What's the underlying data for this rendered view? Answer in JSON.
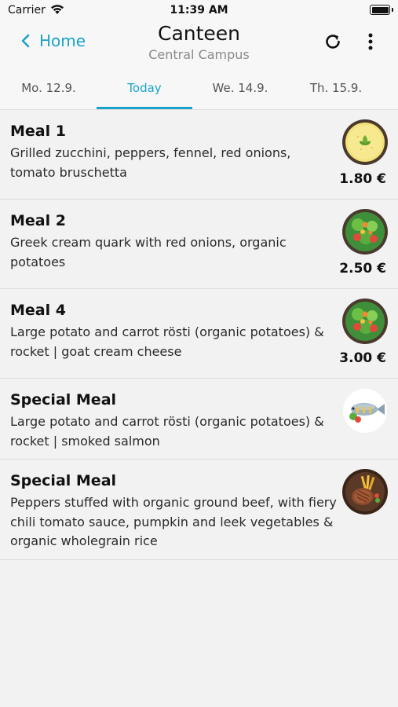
{
  "status_bar": {
    "carrier": "Carrier",
    "time": "11:39 AM"
  },
  "nav": {
    "back_label": "Home",
    "title": "Canteen",
    "subtitle": "Central Campus"
  },
  "tabs": [
    {
      "label": "Mo. 12.9.",
      "active": false
    },
    {
      "label": "Today",
      "active": true
    },
    {
      "label": "We. 14.9.",
      "active": false
    },
    {
      "label": "Th. 15.9.",
      "active": false
    }
  ],
  "meals": [
    {
      "name": "Meal 1",
      "description": "Grilled zucchini, peppers, fennel, red onions, tomato bruschetta",
      "price": "1.80 €",
      "icon": "soup-bowl-icon"
    },
    {
      "name": "Meal 2",
      "description": "Greek cream quark with red onions, organic potatoes",
      "price": "2.50 €",
      "icon": "salad-bowl-icon"
    },
    {
      "name": "Meal 4",
      "description": "Large potato and carrot rösti (organic potatoes) & rocket | goat cream cheese",
      "price": "3.00 €",
      "icon": "salad-bowl-icon"
    },
    {
      "name": "Special Meal",
      "description": "Large potato and carrot rösti (organic potatoes) & rocket | smoked salmon",
      "price": "",
      "icon": "fish-plate-icon"
    },
    {
      "name": "Special Meal",
      "description": "Peppers stuffed with organic ground beef, with fiery chili tomato sauce, pumpkin and leek vegetables & organic wholegrain rice",
      "price": "",
      "icon": "steak-fries-icon"
    }
  ],
  "colors": {
    "accent": "#1aa3c9",
    "background": "#f2f2f2",
    "bar": "#f7f7f7"
  }
}
